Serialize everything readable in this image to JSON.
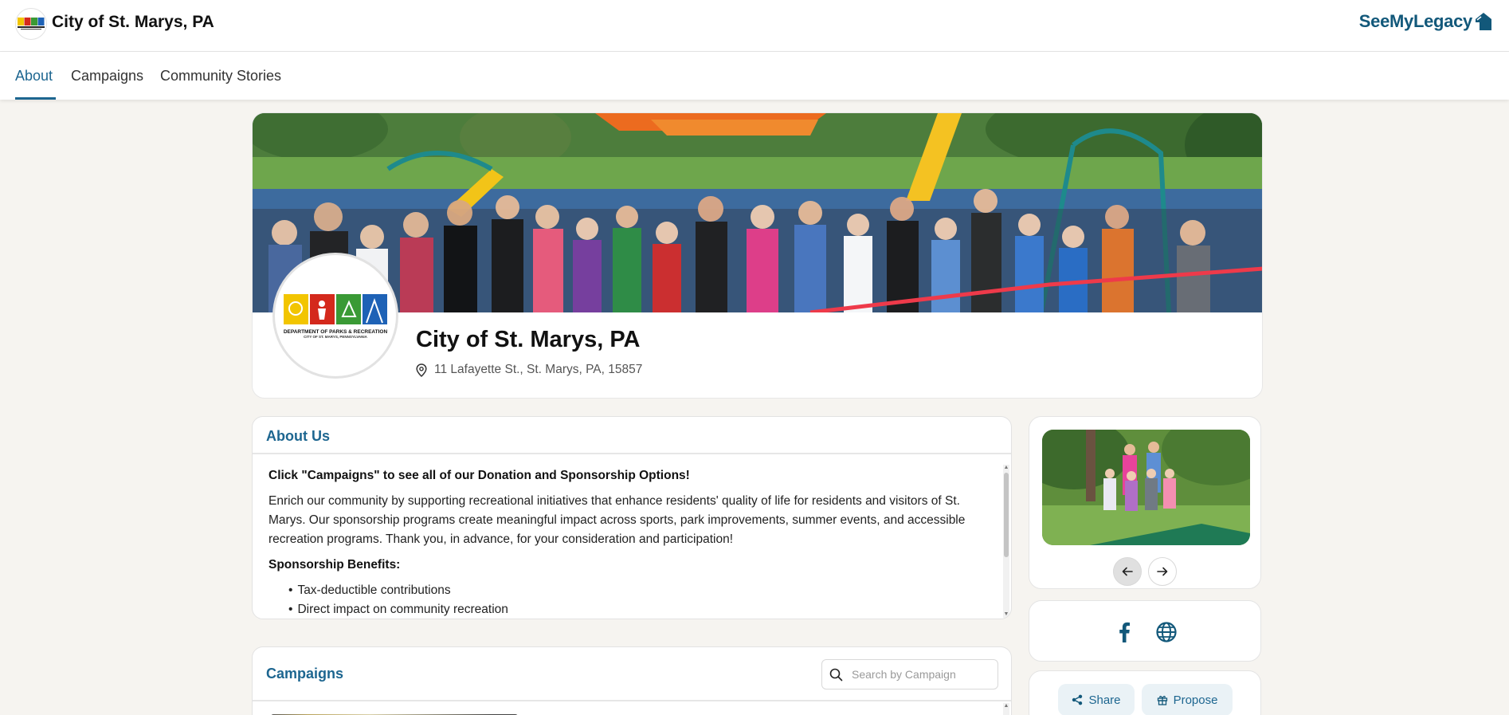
{
  "header": {
    "org_title": "City of St. Marys, PA",
    "brand_name": "SeeMyLegacy",
    "brand_color": "#12587a"
  },
  "tabs": [
    {
      "label": "About",
      "active": true
    },
    {
      "label": "Campaigns",
      "active": false
    },
    {
      "label": "Community Stories",
      "active": false
    }
  ],
  "profile": {
    "name": "City of St. Marys, PA",
    "address": "11 Lafayette St., St. Marys, PA, 15857",
    "logo_line1": "DEPARTMENT OF PARKS & RECREATION",
    "logo_line2": "CITY OF ST. MARYS, PENNSYLVANIA"
  },
  "about": {
    "title": "About Us",
    "cta": "Click \"Campaigns\" to see all of our Donation and Sponsorship Options!",
    "paragraph": "Enrich our community by supporting recreational initiatives that enhance residents' quality of life for residents and visitors of St. Marys. Our sponsorship programs create meaningful impact across sports, park improvements, summer events, and accessible recreation programs. Thank you, in advance, for your consideration and participation!",
    "benefits_heading": "Sponsorship Benefits:",
    "benefits": [
      "Tax-deductible contributions",
      "Direct impact on community recreation"
    ]
  },
  "campaigns": {
    "title": "Campaigns",
    "search_placeholder": "Search by Campaign"
  },
  "sidebar": {
    "share_label": "Share",
    "propose_label": "Propose"
  },
  "icons": {
    "location": "map-pin-icon",
    "search": "search-icon",
    "facebook": "facebook-icon",
    "website": "globe-icon",
    "share": "share-icon",
    "propose": "gift-icon",
    "prev": "arrow-left-icon",
    "next": "arrow-right-icon"
  },
  "colors": {
    "accent": "#1d6690",
    "page_bg": "#f6f4f0",
    "pill_bg": "#eaf2f6"
  }
}
